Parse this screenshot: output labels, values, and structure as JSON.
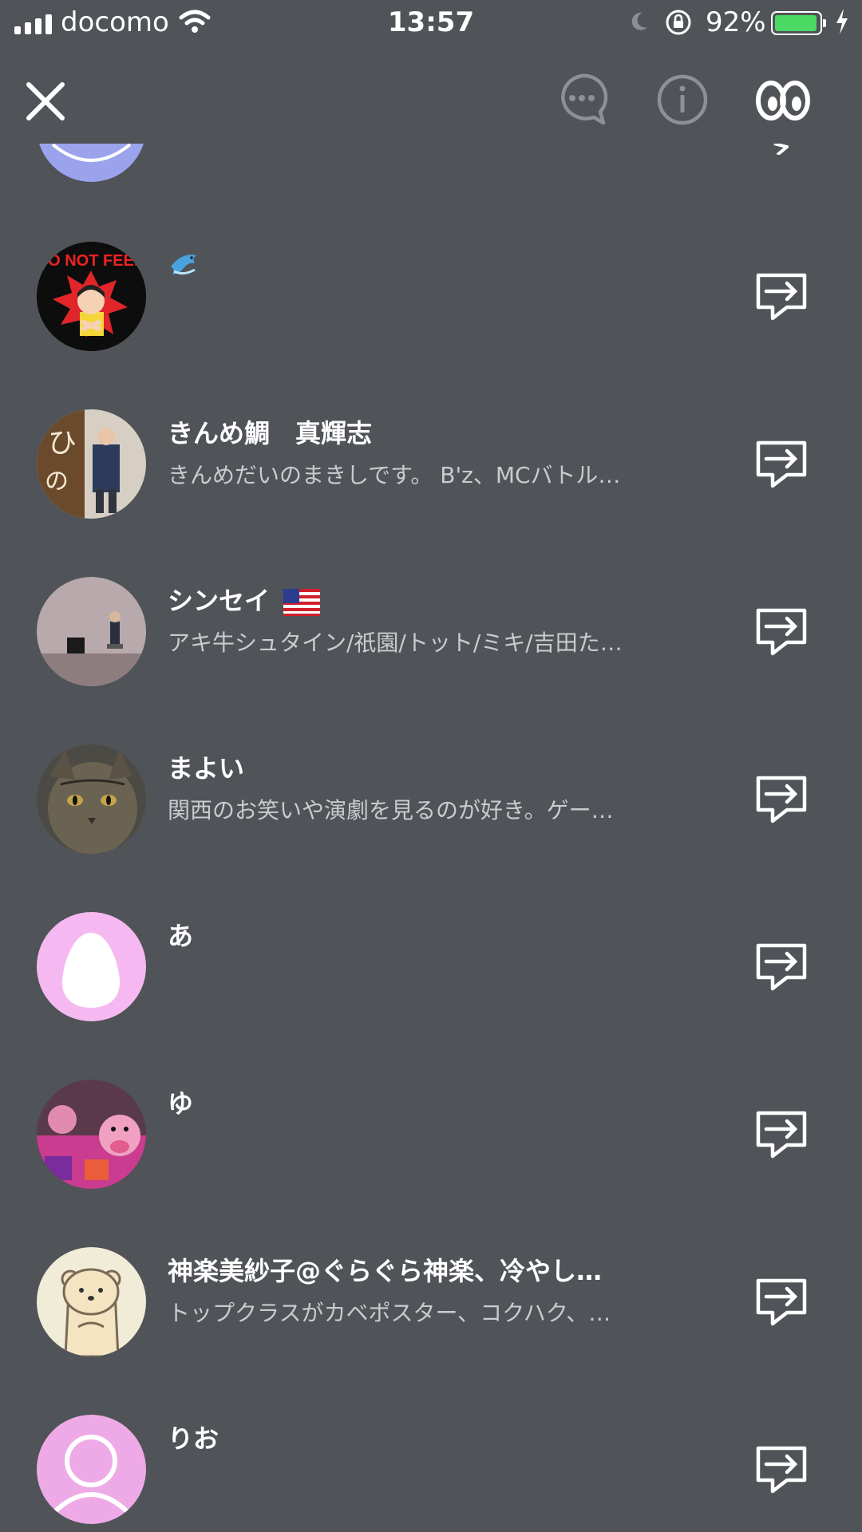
{
  "status_bar": {
    "carrier": "docomo",
    "time": "13:57",
    "battery_percent": "92%",
    "battery_level": 0.92
  },
  "header": {
    "icons": [
      "close-icon",
      "chat-bubble-icon",
      "info-icon",
      "eyes-icon"
    ]
  },
  "friends": [
    {
      "name": "",
      "description": "",
      "name_emoji": "dolphin"
    },
    {
      "name": "きんめ鯛　真輝志",
      "description": "きんめだいのまきしです。 B'z、MCバトル…"
    },
    {
      "name": "シンセイ",
      "description": "アキ牛シュタイン/祇園/トット/ミキ/吉田た…",
      "name_emoji": "us-flag"
    },
    {
      "name": "まよい",
      "description": "関西のお笑いや演劇を見るのが好き。ゲー…"
    },
    {
      "name": "あ",
      "description": ""
    },
    {
      "name": "ゆ",
      "description": ""
    },
    {
      "name": "神楽美紗子@ぐらぐら神楽、冷やし…",
      "description": "トップクラスがカベポスター、コクハク、…"
    },
    {
      "name": "りお",
      "description": ""
    }
  ],
  "avatar_text": {
    "do_not_feed": "DO NOT FEED"
  }
}
